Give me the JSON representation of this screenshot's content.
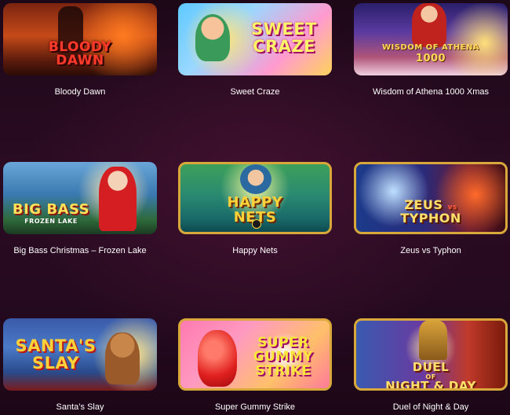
{
  "games": [
    {
      "title": "Bloody Dawn",
      "logo_lines": [
        "BLOODY",
        "DAWN"
      ]
    },
    {
      "title": "Sweet Craze",
      "logo_lines": [
        "SWEET",
        "CRAZE"
      ]
    },
    {
      "title": "Wisdom of Athena 1000 Xmas",
      "logo_lines": [
        "WISDOM OF ATHENA",
        "1000"
      ]
    },
    {
      "title": "Big Bass Christmas – Frozen Lake",
      "logo_lines": [
        "BIG BASS",
        "FROZEN LAKE"
      ]
    },
    {
      "title": "Happy Nets",
      "logo_lines": [
        "HAPPY",
        "NETS"
      ]
    },
    {
      "title": "Zeus vs Typhon",
      "logo_lines": [
        "ZEUS",
        "vs",
        "TYPHON"
      ]
    },
    {
      "title": "Santa’s Slay",
      "logo_lines": [
        "SANTA'S",
        "SLAY"
      ]
    },
    {
      "title": "Super Gummy Strike",
      "logo_lines": [
        "SUPER",
        "GUMMY",
        "STRIKE"
      ]
    },
    {
      "title": "Duel of Night & Day",
      "logo_lines": [
        "DUEL",
        "OF",
        "NIGHT & DAY"
      ]
    }
  ],
  "colors": {
    "background": "#2a0b22",
    "caption_text": "#ffffff",
    "highlight_border": "#d8a93a"
  },
  "icons": [
    "paw-icon"
  ]
}
